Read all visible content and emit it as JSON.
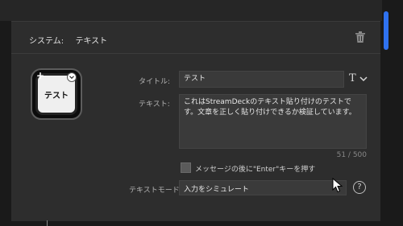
{
  "header": {
    "plugin": "システム:",
    "action": "テキスト"
  },
  "key": {
    "label": "テスト"
  },
  "form": {
    "title_label": "タイトル:",
    "title_value": "テスト",
    "text_label": "テキスト:",
    "text_value": "これはStreamDeckのテキスト貼り付けのテストです。文章を正しく貼り付けできるか検証しています。",
    "counter": "51 / 500",
    "enter_label": "メッセージの後に\"Enter\"キーを押す",
    "mode_label": "テキストモード:",
    "mode_value": "入力をシミュレート",
    "font_button": "T",
    "help": "?"
  },
  "colors": {
    "accent": "#2f72f0",
    "panel": "#2d2d2d",
    "field": "#3a3a3a"
  },
  "icons": [
    "trash-icon",
    "plus-icon",
    "chevron-down-icon",
    "help-icon",
    "cursor-icon"
  ]
}
